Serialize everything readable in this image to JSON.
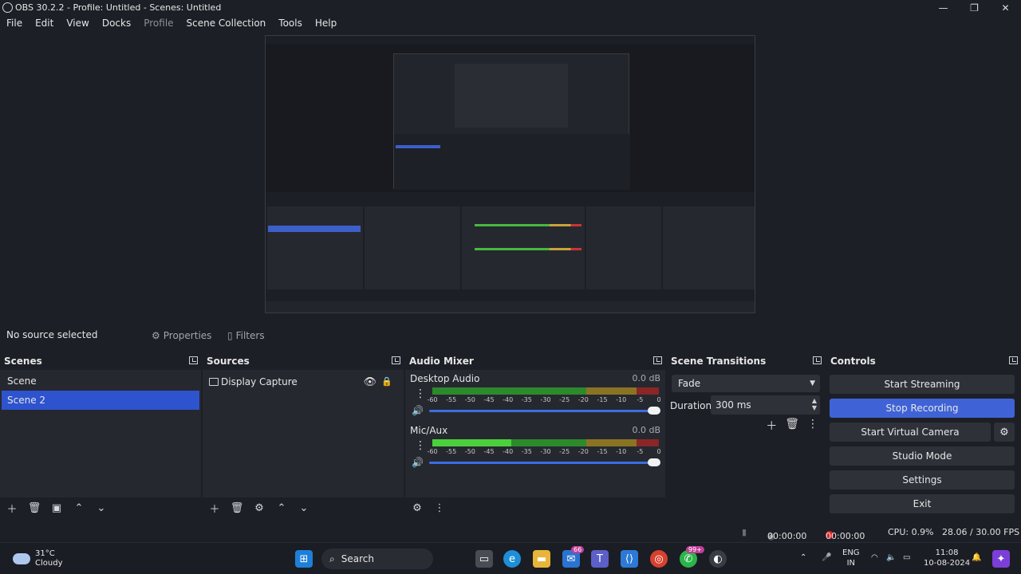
{
  "window": {
    "title": "OBS 30.2.2 - Profile: Untitled - Scenes: Untitled",
    "minimize": "—",
    "maximize": "❐",
    "close": "✕"
  },
  "menu": [
    "File",
    "Edit",
    "View",
    "Docks",
    "Profile",
    "Scene Collection",
    "Tools",
    "Help"
  ],
  "source_toolbar": {
    "status": "No source selected",
    "properties": "Properties",
    "filters": "Filters"
  },
  "scenes": {
    "title": "Scenes",
    "items": [
      "Scene",
      "Scene 2"
    ],
    "selected_index": 1
  },
  "sources": {
    "title": "Sources",
    "items": [
      {
        "name": "Display Capture",
        "visible": true,
        "locked": false
      }
    ]
  },
  "audio_mixer": {
    "title": "Audio Mixer",
    "channels": [
      {
        "name": "Desktop Audio",
        "db": "0.0 dB",
        "level": 0.0
      },
      {
        "name": "Mic/Aux",
        "db": "0.0 dB",
        "level": 0.35
      }
    ],
    "ticks": [
      "-60",
      "-55",
      "-50",
      "-45",
      "-40",
      "-35",
      "-30",
      "-25",
      "-20",
      "-15",
      "-10",
      "-5",
      "0"
    ]
  },
  "transitions": {
    "title": "Scene Transitions",
    "selected": "Fade",
    "duration_label": "Duration",
    "duration_value": "300 ms"
  },
  "controls": {
    "title": "Controls",
    "start_streaming": "Start Streaming",
    "stop_recording": "Stop Recording",
    "start_virtual_camera": "Start Virtual Camera",
    "studio_mode": "Studio Mode",
    "settings": "Settings",
    "exit": "Exit"
  },
  "statusbar": {
    "stream_time": "00:00:00",
    "rec_time": "00:00:00",
    "cpu": "CPU: 0.9%",
    "fps": "28.06 / 30.00 FPS"
  },
  "taskbar": {
    "temperature": "31°C",
    "condition": "Cloudy",
    "search": "Search",
    "lang_top": "ENG",
    "lang_bottom": "IN",
    "time": "11:08",
    "date": "10-08-2024",
    "badge_mail": "66",
    "badge_whatsapp": "99+"
  },
  "colors": {
    "accent": "#2e53ce",
    "record": "#d8262c",
    "meter_green": "#4ccf3c"
  }
}
